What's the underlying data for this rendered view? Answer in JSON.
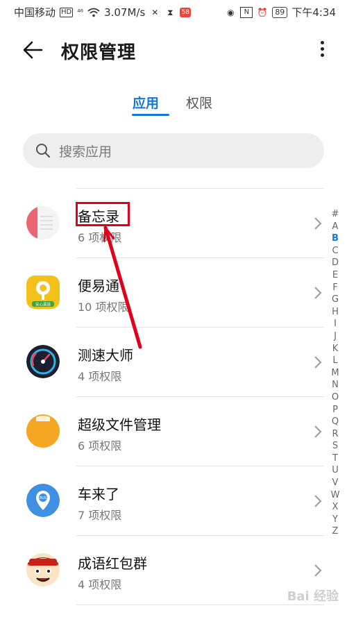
{
  "status_bar": {
    "carrier": "中国移动",
    "hd_badge": "HD",
    "network": "⁴⁶",
    "speed": "3.07M/s",
    "battery": "89",
    "time": "下午4:34"
  },
  "header": {
    "title": "权限管理"
  },
  "tabs": [
    {
      "label": "应用",
      "active": true
    },
    {
      "label": "权限",
      "active": false
    }
  ],
  "search": {
    "placeholder": "搜索应用"
  },
  "apps": [
    {
      "name": "备忘录",
      "count": "6 项权限",
      "icon": "memo-icon"
    },
    {
      "name": "便易通",
      "count": "10 项权限",
      "icon": "bianyitong-icon"
    },
    {
      "name": "测速大师",
      "count": "4 项权限",
      "icon": "speedometer-icon"
    },
    {
      "name": "超级文件管理",
      "count": "6 项权限",
      "icon": "folder-icon"
    },
    {
      "name": "车来了",
      "count": "7 项权限",
      "icon": "bus-pin-icon"
    },
    {
      "name": "成语红包群",
      "count": "4 项权限",
      "icon": "idiom-character-icon"
    }
  ],
  "alpha_index": [
    "#",
    "A",
    "B",
    "C",
    "D",
    "E",
    "F",
    "G",
    "H",
    "I",
    "J",
    "K",
    "L",
    "M",
    "N",
    "O",
    "P",
    "Q",
    "R",
    "S",
    "T",
    "U",
    "V",
    "W",
    "X",
    "Y",
    "Z"
  ],
  "alpha_active": "B",
  "icon_text": {
    "bianyitong": "安心渠道",
    "bus": "BUS"
  },
  "watermark": "Bai 经验",
  "colors": {
    "accent": "#1677d9",
    "annotation_red": "#e0001b"
  }
}
